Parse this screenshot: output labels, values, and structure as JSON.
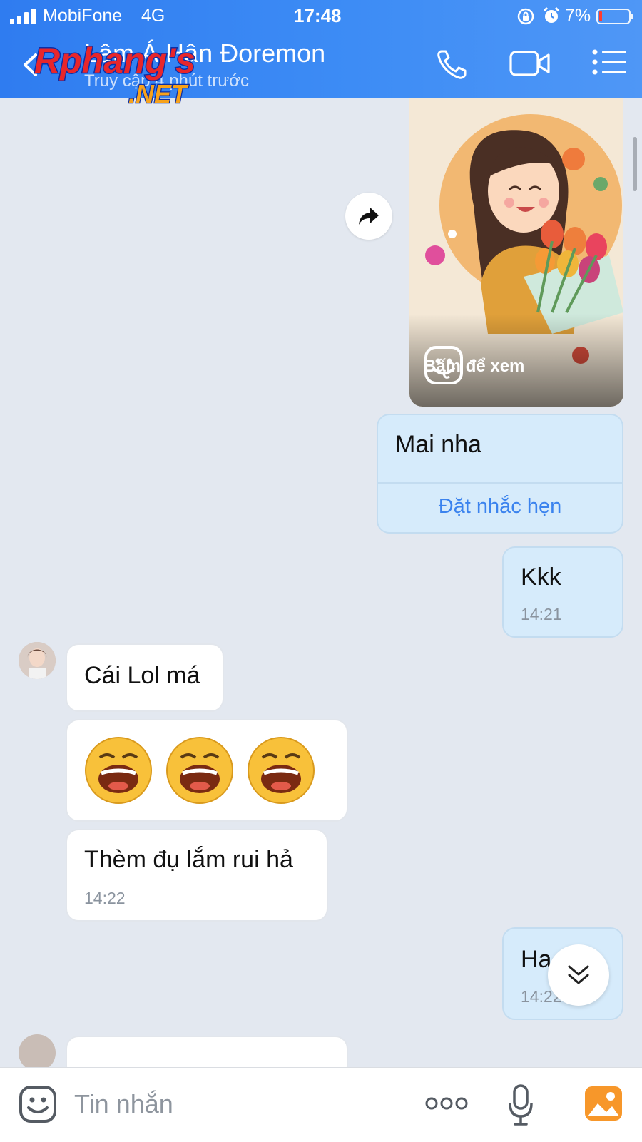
{
  "status_bar": {
    "carrier": "MobiFone",
    "network": "4G",
    "time": "17:48",
    "battery": "7%"
  },
  "header": {
    "contact_name": "Lâm Á Hân Đoremon",
    "last_seen": "Truy cập 4 phút trước",
    "watermark": "Rphang's .NET",
    "icons": [
      "back-icon",
      "phone-icon",
      "video-camera-icon",
      "menu-list-icon"
    ]
  },
  "messages": [
    {
      "type": "image",
      "direction": "outgoing",
      "overlay_label": "Bấm để xem"
    },
    {
      "type": "text",
      "direction": "outgoing",
      "text": "Mai nha",
      "action": "Đặt nhắc hẹn"
    },
    {
      "type": "text",
      "direction": "outgoing",
      "text": "Kkk",
      "time": "14:21"
    },
    {
      "type": "text",
      "direction": "incoming",
      "text": "Cái Lol má"
    },
    {
      "type": "emoji",
      "direction": "incoming",
      "emoji": [
        "laughing-emoji",
        "laughing-emoji",
        "laughing-emoji"
      ]
    },
    {
      "type": "text",
      "direction": "incoming",
      "text": "Thèm đụ lắm rui hả",
      "time": "14:22"
    },
    {
      "type": "text",
      "direction": "outgoing",
      "text": "Ha",
      "time": "14:22"
    }
  ],
  "input": {
    "placeholder": "Tin nhắn"
  },
  "colors": {
    "header_blue": "#3d8cf5",
    "outgoing_bubble": "#d6ebfb",
    "incoming_bubble": "#ffffff",
    "link_blue": "#3b83ee",
    "chat_bg": "#e3e8f0"
  }
}
